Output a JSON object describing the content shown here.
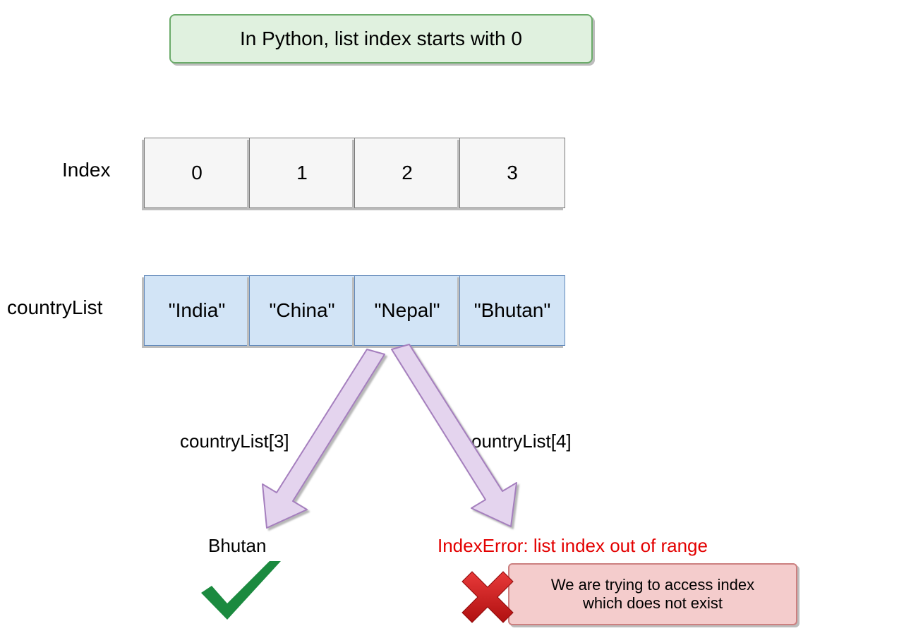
{
  "title": "In Python, list index starts with 0",
  "labels": {
    "index": "Index",
    "list": "countryList"
  },
  "indexRow": [
    "0",
    "1",
    "2",
    "3"
  ],
  "listRow": [
    "\"India\"",
    "\"China\"",
    "\"Nepal\"",
    "\"Bhutan\""
  ],
  "operations": {
    "left": {
      "expr": "countryList[3]",
      "result": "Bhutan"
    },
    "right": {
      "expr": "countryList[4]",
      "error": "IndexError: list index out of range",
      "explanation": "We are trying to access index\nwhich does not exist"
    }
  },
  "colors": {
    "titleFill": "#e0f1df",
    "titleStroke": "#6bab6a",
    "indexFill": "#f6f6f6",
    "indexStroke": "#787878",
    "listFill": "#d2e4f6",
    "listStroke": "#6289bb",
    "arrowFill": "#e4d4ee",
    "arrowStroke": "#a57fbe",
    "errFill": "#f4cccc",
    "errStroke": "#cc8080",
    "errorText": "#e30000",
    "checkGreen": "#1b8a3f",
    "crossRed": "#d31717"
  }
}
